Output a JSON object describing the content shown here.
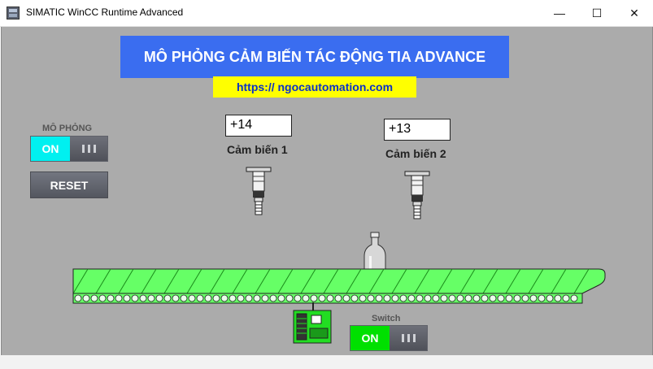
{
  "window": {
    "title": "SIMATIC WinCC Runtime Advanced",
    "icon": "wincc-app-icon",
    "controls": {
      "minimize": "—",
      "maximize": "☐",
      "close": "✕"
    }
  },
  "header": {
    "title": "MÔ PHỎNG CẢM BIẾN TÁC ĐỘNG TIA ADVANCE",
    "url": "https:// ngocautomation.com",
    "title_bg": "#3a6df0",
    "url_bg": "#ffff00"
  },
  "simulation": {
    "label": "MÔ PHỎNG",
    "toggle_on": "ON",
    "on_color": "#00f0f0"
  },
  "reset": {
    "label": "RESET"
  },
  "sensors": [
    {
      "value": "+14",
      "name": "Cảm biến 1"
    },
    {
      "value": "+13",
      "name": "Cảm biến 2"
    }
  ],
  "switch": {
    "label": "Switch",
    "toggle_on": "ON",
    "on_color": "#00e000"
  },
  "colors": {
    "conveyor": "#66ff66",
    "motor": "#22dd22",
    "panel_bg": "#ababab"
  }
}
